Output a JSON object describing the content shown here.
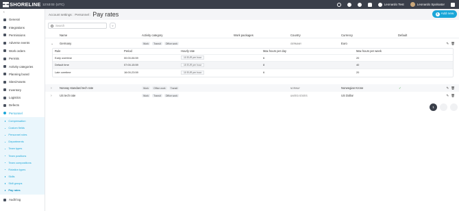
{
  "topbar": {
    "logo_text": "SHORELINE",
    "time": "12:53:03",
    "timezone": "(UTC)",
    "account_name": "Leonardo Test",
    "user_name": "Leonardo Spoloator"
  },
  "sidebar": {
    "items": [
      {
        "label": "General",
        "icon": "gear-icon"
      },
      {
        "label": "Integrations",
        "icon": "link-icon"
      },
      {
        "label": "Permissions",
        "icon": "lock-icon"
      },
      {
        "label": "Adverse events",
        "icon": "alert-icon"
      },
      {
        "label": "Work orders",
        "icon": "document-icon"
      },
      {
        "label": "Permits",
        "icon": "permit-icon"
      },
      {
        "label": "Activity categories",
        "icon": "tag-icon"
      },
      {
        "label": "Planning board",
        "icon": "board-icon"
      },
      {
        "label": "Sites/Assets",
        "icon": "building-icon"
      },
      {
        "label": "Inventory",
        "icon": "wrench-icon"
      },
      {
        "label": "Logistics",
        "icon": "truck-icon"
      },
      {
        "label": "Defects",
        "icon": "flag-icon"
      },
      {
        "label": "Personnel",
        "icon": "person-icon"
      }
    ],
    "sub_items": [
      {
        "label": "Compensation"
      },
      {
        "label": "Custom fields"
      },
      {
        "label": "Personnel roles"
      },
      {
        "label": "Departments"
      },
      {
        "label": "Team types"
      },
      {
        "label": "Team positions"
      },
      {
        "label": "Team compositions"
      },
      {
        "label": "Rotation types"
      },
      {
        "label": "Skills"
      },
      {
        "label": "Skill groups"
      },
      {
        "label": "Pay rates"
      }
    ],
    "footer_item": {
      "label": "Audit log",
      "icon": "shield-icon"
    }
  },
  "header": {
    "breadcrumb_root": "Account settings",
    "breadcrumb_section": "Personnel",
    "title": "Pay rates",
    "add_button": "Add new"
  },
  "search": {
    "placeholder": "Search"
  },
  "table": {
    "columns": {
      "name": "Name",
      "activity": "Activity category",
      "packages": "Work packages",
      "country": "Country",
      "currency": "Currency",
      "default": "Default"
    },
    "rows": [
      {
        "name": "Germany",
        "tags": [
          "Work",
          "Transit",
          "Office work"
        ],
        "country": "GERMANY",
        "currency": "Euro",
        "default": false,
        "expanded": true
      },
      {
        "name": "Norway standard tech rate",
        "tags": [
          "Work",
          "Office work",
          "Transit"
        ],
        "country": "NORWAY",
        "currency": "Norwegian Krone",
        "default": true,
        "expanded": false
      },
      {
        "name": "US tech rate",
        "tags": [
          "Work",
          "Transit",
          "Office work"
        ],
        "country": "UNITED STATES",
        "currency": "US Dollar",
        "default": false,
        "expanded": false
      }
    ]
  },
  "nested": {
    "columns": {
      "rule": "Rule",
      "period": "Period",
      "rate": "Hourly rate",
      "max_day": "Max hours per day",
      "max_week": "Max hours per week"
    },
    "rows": [
      {
        "rule": "Early overtime",
        "period": "00:00-06:59",
        "rate": "10 EUR per hour",
        "max_day": "6",
        "max_week": "20"
      },
      {
        "rule": "Default time",
        "period": "07:00-15:59",
        "rate": "15 EUR per hour",
        "max_day": "8",
        "max_week": "40"
      },
      {
        "rule": "Late overtime",
        "period": "16:00-23:59",
        "rate": "10 EUR per hour",
        "max_day": "6",
        "max_week": "20"
      }
    ]
  },
  "pagination": {
    "current": "1"
  },
  "colors": {
    "accent": "#1aa6d8",
    "topbar": "#3a3f4a"
  }
}
